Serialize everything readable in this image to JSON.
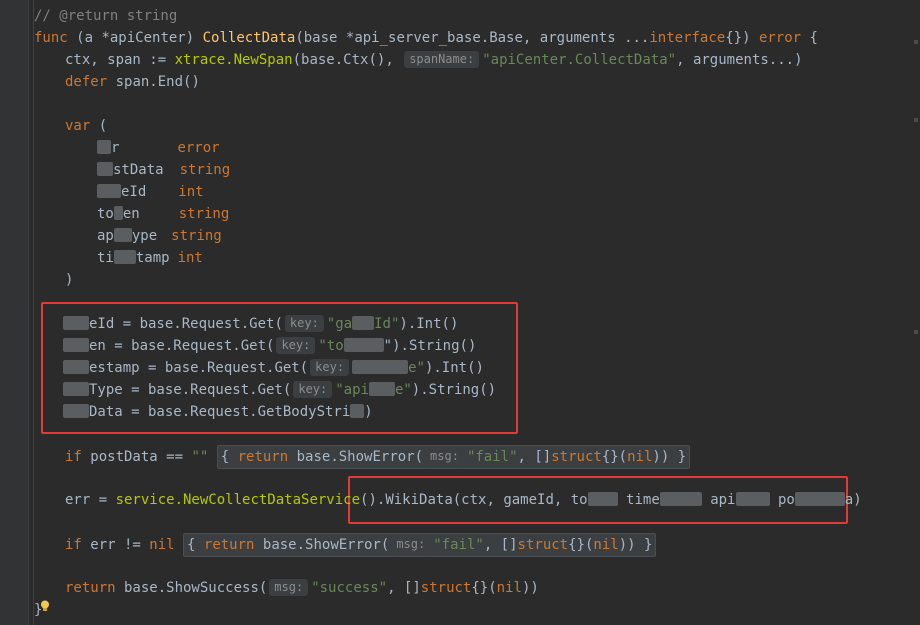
{
  "lines": {
    "l0": "// @return string",
    "func_kw": "func",
    "recv": "(a *apiCenter)",
    "fname": "CollectData",
    "params_a": "(base *api_server_base.",
    "params_b": "Base",
    "params_c": ", arguments ...",
    "params_d": "interface",
    "params_e": "{}) ",
    "ret": "error",
    "brace": " {",
    "l2_a": "ctx, span := ",
    "l2_fn": "xtrace.NewSpan",
    "l2_b": "(base.",
    "l2_ctx": "Ctx",
    "l2_c": "(), ",
    "l2_hint": "spanName:",
    "l2_str": "\"apiCenter.CollectData\"",
    "l2_d": ", arguments...)",
    "l3_kw": "defer",
    "l3_b": " span.End()",
    "var_kw": "var",
    "var_open": " (",
    "v1_name": "r",
    "v1_type": "error",
    "v2_name": "stData",
    "v2_type": "string",
    "v3_name": "eId",
    "v3_type": "int",
    "v4_name_a": "to",
    "v4_name_b": "en",
    "v4_type": "string",
    "v5_name_a": "ap",
    "v5_name_b": "ype",
    "v5_type": "string",
    "v6_name_a": "ti",
    "v6_name_b": "tamp",
    "v6_type": "int",
    "var_close": ")",
    "a1_a": "eId = base.Request.",
    "a1_fn": "Get",
    "a1_hint": "key:",
    "a1_str_a": "\"ga",
    "a1_str_b": "Id\"",
    "a1_b": ").Int()",
    "a2_a": "en = base.Request.",
    "a2_fn": "Get",
    "a2_hint": "key:",
    "a2_str": "\"to",
    "a2_b": "\").String()",
    "a3_a": "estamp = base.Request.",
    "a3_fn": "Get",
    "a3_hint": "key:",
    "a3_str": "e\"",
    "a3_b": ").Int()",
    "a4_a": "Type = base.Request.",
    "a4_fn": "Get",
    "a4_hint": "key:",
    "a4_str_a": "\"api",
    "a4_str_b": "e\"",
    "a4_b": ").String()",
    "a5_a": "Data = base.Request.",
    "a5_fn": "GetBodyStri",
    "a5_b": ")",
    "if1_kw": "if",
    "if1_a": " postData == ",
    "if1_str": "\"\"",
    "if1_ret": "return",
    "if1_b": " base.ShowError(",
    "if1_hint": "msg:",
    "if1_str2": "\"fail\"",
    "if1_c": ", []",
    "if1_struct": "struct",
    "if1_d": "{}(",
    "if1_nil": "nil",
    "if1_e": "))",
    "svc_a": "err = ",
    "svc_fn": "service.NewCollectDataService",
    "svc_b": "().",
    "svc_m": "WikiData",
    "svc_c": "(ctx, gameId, to",
    "svc_d": "time",
    "svc_e": "api",
    "svc_f": "po",
    "svc_g": "a)",
    "if2_kw": "if",
    "if2_a": " err != ",
    "if2_nil": "nil",
    "if2_ret": "return",
    "if2_b": " base.ShowError(",
    "if2_hint": "msg:",
    "if2_str": "\"fail\"",
    "if2_c": ", []",
    "if2_struct": "struct",
    "if2_d": "{}(",
    "if2_nil2": "nil",
    "if2_e": "))",
    "ret_kw": "return",
    "ret_a": " base.ShowSuccess(",
    "ret_hint": "msg:",
    "ret_str": "\"success\"",
    "ret_b": ", []",
    "ret_struct": "struct",
    "ret_c": "{}(",
    "ret_nil": "nil",
    "ret_d": "))",
    "end": "}"
  },
  "colors": {
    "background": "#2b2b2b",
    "keyword": "#cc7832",
    "function": "#ffc66d",
    "string": "#6a8759",
    "annotation_box": "#e53935"
  }
}
